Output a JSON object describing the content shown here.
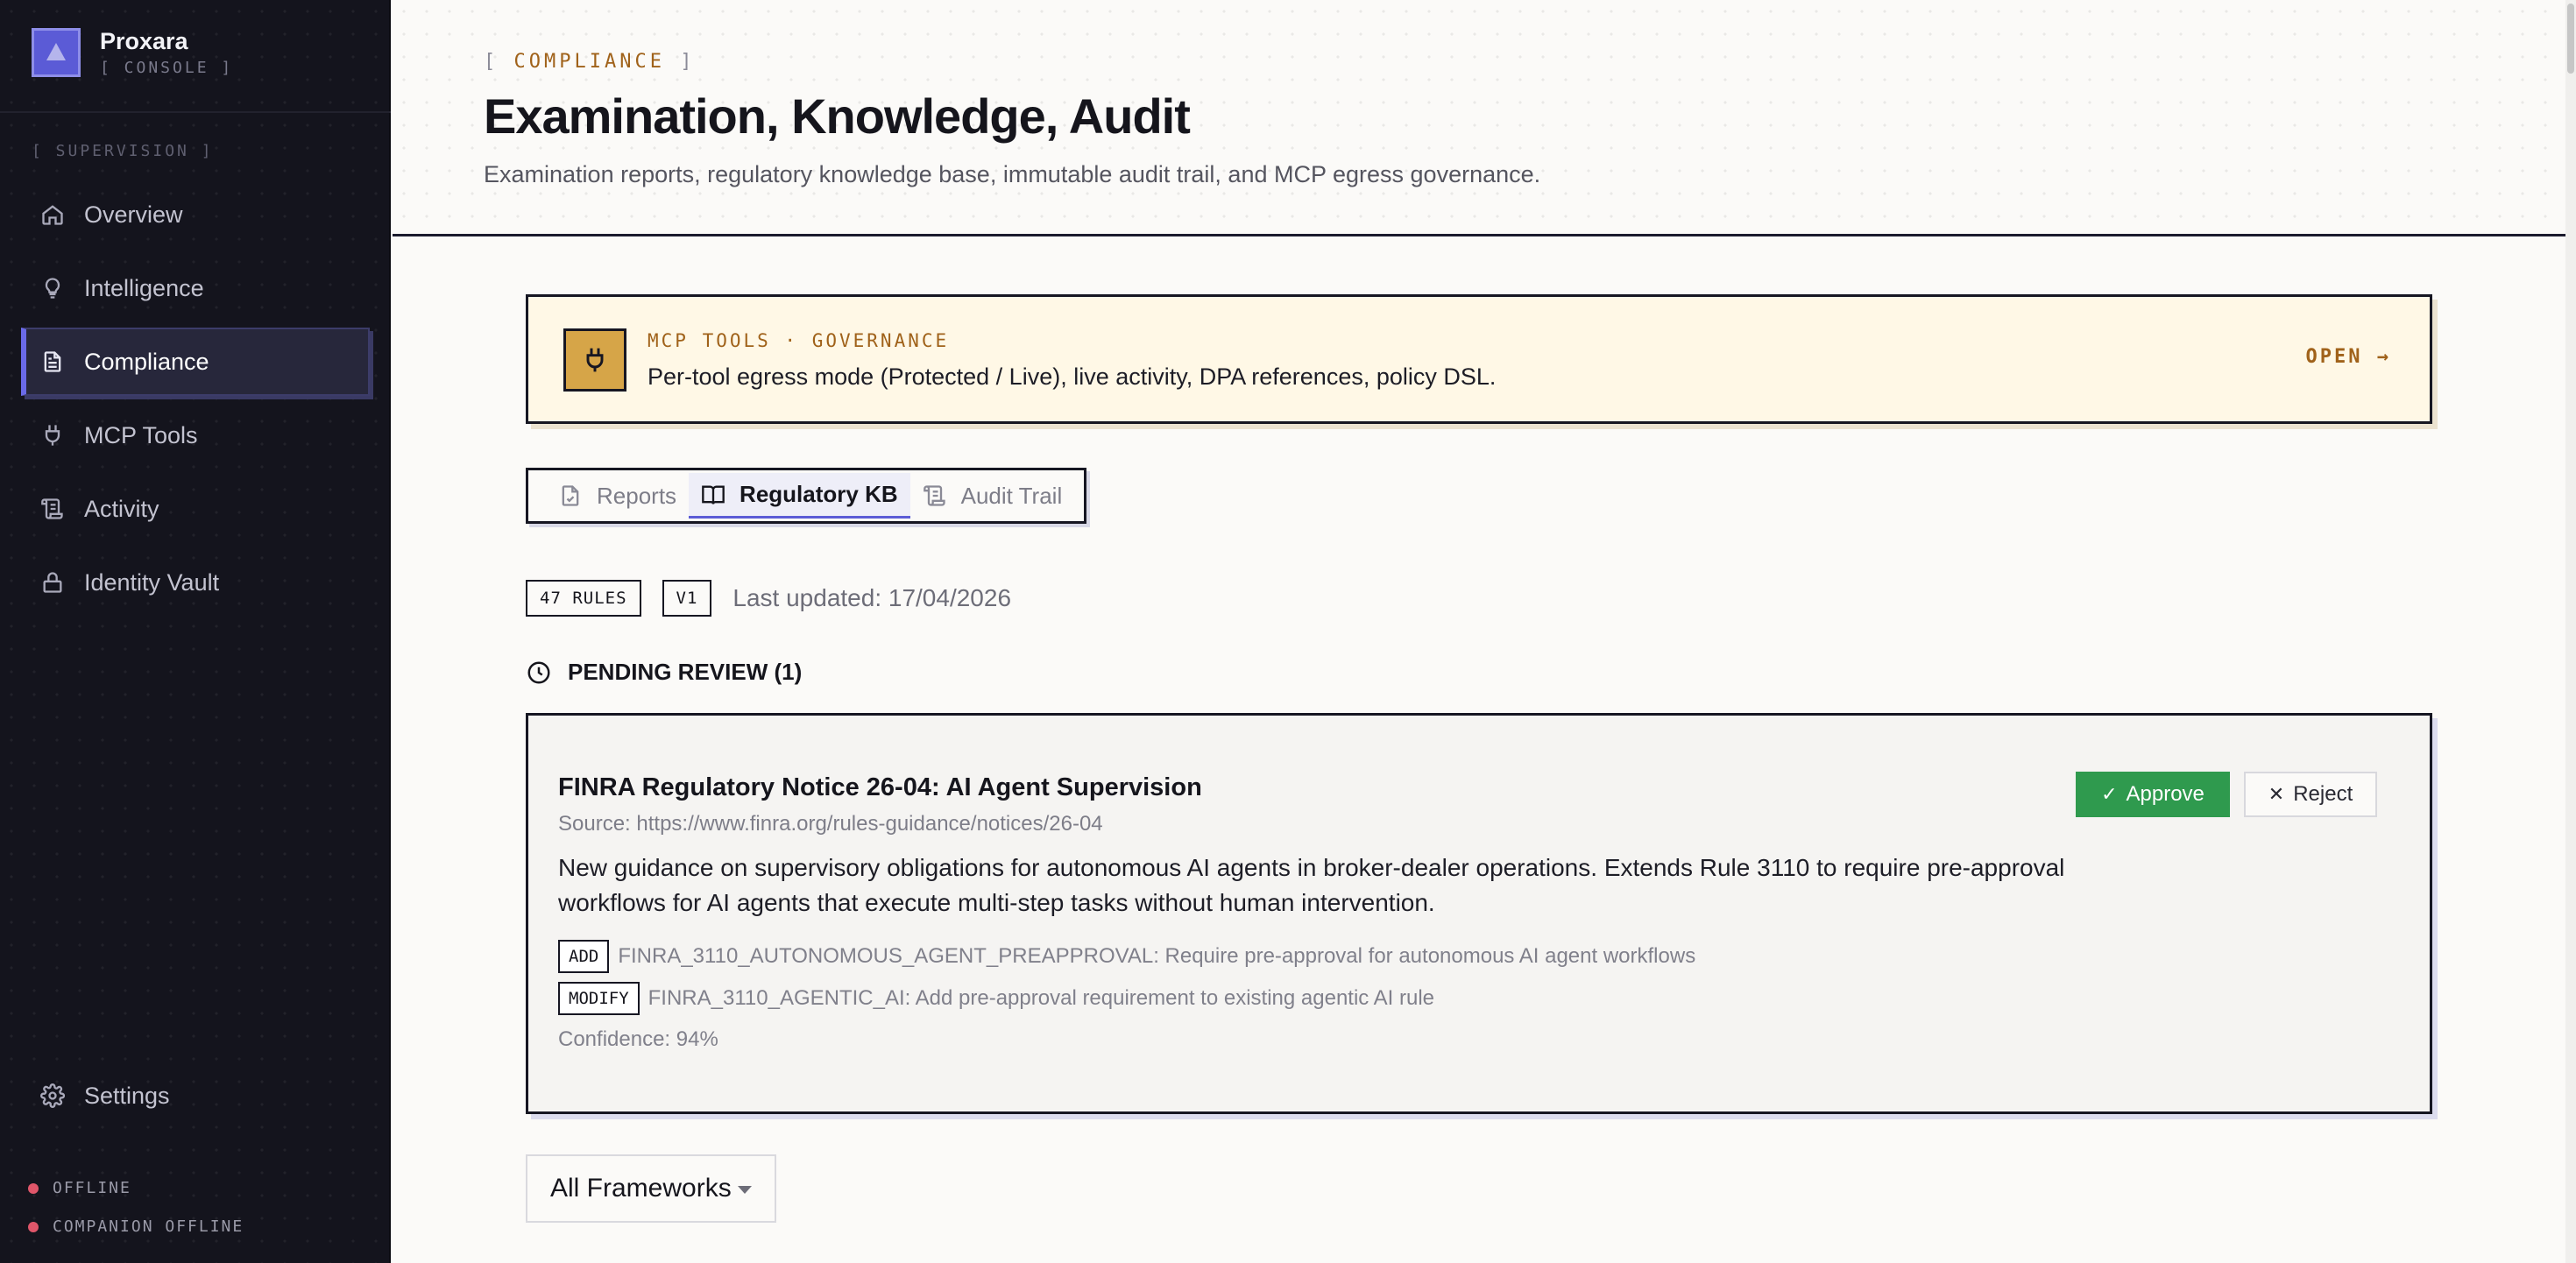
{
  "app": {
    "name": "Proxara",
    "subtitle": "[ CONSOLE ]"
  },
  "sidebar": {
    "section_label": "[ SUPERVISION ]",
    "items": [
      {
        "label": "Overview",
        "icon": "home-icon"
      },
      {
        "label": "Intelligence",
        "icon": "lightbulb-icon"
      },
      {
        "label": "Compliance",
        "icon": "document-icon",
        "active": true
      },
      {
        "label": "MCP Tools",
        "icon": "plug-icon"
      },
      {
        "label": "Activity",
        "icon": "scroll-icon"
      },
      {
        "label": "Identity Vault",
        "icon": "lock-icon"
      }
    ],
    "settings_label": "Settings",
    "status": [
      {
        "label": "OFFLINE",
        "color": "#e0566a"
      },
      {
        "label": "COMPANION OFFLINE",
        "color": "#e0566a"
      }
    ]
  },
  "header": {
    "eyebrow_open": "[",
    "eyebrow": "COMPLIANCE",
    "eyebrow_close": "]",
    "title": "Examination, Knowledge, Audit",
    "subtitle": "Examination reports, regulatory knowledge base, immutable audit trail, and MCP egress governance."
  },
  "banner": {
    "eyebrow": "MCP TOOLS · GOVERNANCE",
    "text": "Per-tool egress mode (Protected / Live), live activity, DPA references, policy DSL.",
    "action": "OPEN →"
  },
  "tabs": [
    {
      "label": "Reports",
      "icon": "file-check-icon"
    },
    {
      "label": "Regulatory KB",
      "icon": "book-open-icon",
      "active": true
    },
    {
      "label": "Audit Trail",
      "icon": "scroll-icon"
    }
  ],
  "kb_meta": {
    "rules_badge": "47 RULES",
    "version_badge": "V1",
    "updated": "Last updated: 17/04/2026"
  },
  "pending": {
    "heading": "PENDING REVIEW (1)",
    "item": {
      "title": "FINRA Regulatory Notice 26-04: AI Agent Supervision",
      "source": "Source: https://www.finra.org/rules-guidance/notices/26-04",
      "description": "New guidance on supervisory obligations for autonomous AI agents in broker-dealer operations. Extends Rule 3110 to require pre-approval workflows for AI agents that execute multi-step tasks without human intervention.",
      "changes": [
        {
          "type": "ADD",
          "text": "FINRA_3110_AUTONOMOUS_AGENT_PREAPPROVAL: Require pre-approval for autonomous AI agent workflows"
        },
        {
          "type": "MODIFY",
          "text": "FINRA_3110_AGENTIC_AI: Add pre-approval requirement to existing agentic AI rule"
        }
      ],
      "confidence": "Confidence: 94%",
      "approve_label": "Approve",
      "reject_label": "Reject"
    }
  },
  "filter": {
    "selected": "All Frameworks"
  },
  "colors": {
    "accent": "#5b5bd6",
    "amber": "#a0621a",
    "approve": "#2f9a4e",
    "sidebar_bg": "#14141d"
  }
}
